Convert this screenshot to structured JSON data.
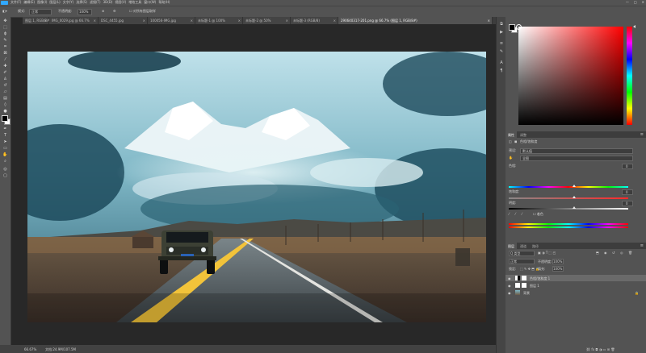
{
  "app": {
    "logo": "Ps"
  },
  "menubar": {
    "items": [
      "文件(F)",
      "编辑(E)",
      "图像(I)",
      "图层(L)",
      "文字(Y)",
      "选择(S)",
      "滤镜(T)",
      "3D(D)",
      "视图(V)",
      "增效工具",
      "窗口(W)",
      "帮助(H)"
    ],
    "window_controls": [
      "—",
      "□",
      "✕"
    ]
  },
  "options_bar": {
    "mode_label": "模式:",
    "mode_value": "正常",
    "opacity_label": "不透明度:",
    "opacity_value": "100%",
    "extra_label": "对所有图层取样"
  },
  "tabs": [
    {
      "label": "图层 1, RGB/8#"
    },
    {
      "label": "IMG_0029.jpg @ 66.7%"
    },
    {
      "label": "DSC_4455.jpg"
    },
    {
      "label": "100056-IMG.jpg"
    },
    {
      "label": "未标题-1 @ 100%"
    },
    {
      "label": "未标题-2 @ 50%"
    },
    {
      "label": "未标题-3 (RGB/8)"
    },
    {
      "label": "290640317-201.png @ 66.7% (图层 1, RGB/8#)",
      "active": true
    }
  ],
  "status": {
    "zoom": "66.67%",
    "doc": "文档:24.9M/107.5M"
  },
  "panels": {
    "adjust_tabs": [
      "属性",
      "调整"
    ],
    "adjust": {
      "title": "色相/饱和度",
      "preset_label": "预设:",
      "preset_value": "默认值",
      "channel_value": "全图",
      "hue_label": "色相:",
      "hue_value": "0",
      "sat_label": "饱和度:",
      "sat_value": "0",
      "light_label": "明度:",
      "light_value": "0",
      "colorize_label": "着色",
      "hue_pos": 0.55,
      "sat_pos": 0.55,
      "light_pos": 0.55
    },
    "layers_tabs": [
      "图层",
      "通道",
      "路径"
    ],
    "layers": {
      "kind_label": "Q 类型",
      "blend_value": "正常",
      "opacity_label": "不透明度:",
      "opacity_value": "100%",
      "lock_label": "锁定:",
      "fill_label": "填充:",
      "fill_value": "100%",
      "items": [
        {
          "name": "色相/饱和度 1",
          "type": "adjustment",
          "selected": true
        },
        {
          "name": "图层 1",
          "type": "pixel",
          "selected": false
        },
        {
          "name": "背景",
          "type": "background",
          "selected": false
        }
      ]
    }
  },
  "colors": {
    "accent": "#31a8ff",
    "panel_bg": "#535353",
    "workspace_bg": "#282828",
    "fg_color": "#000000",
    "bg_color": "#ffffff",
    "picker_hue": "#ff0000"
  }
}
